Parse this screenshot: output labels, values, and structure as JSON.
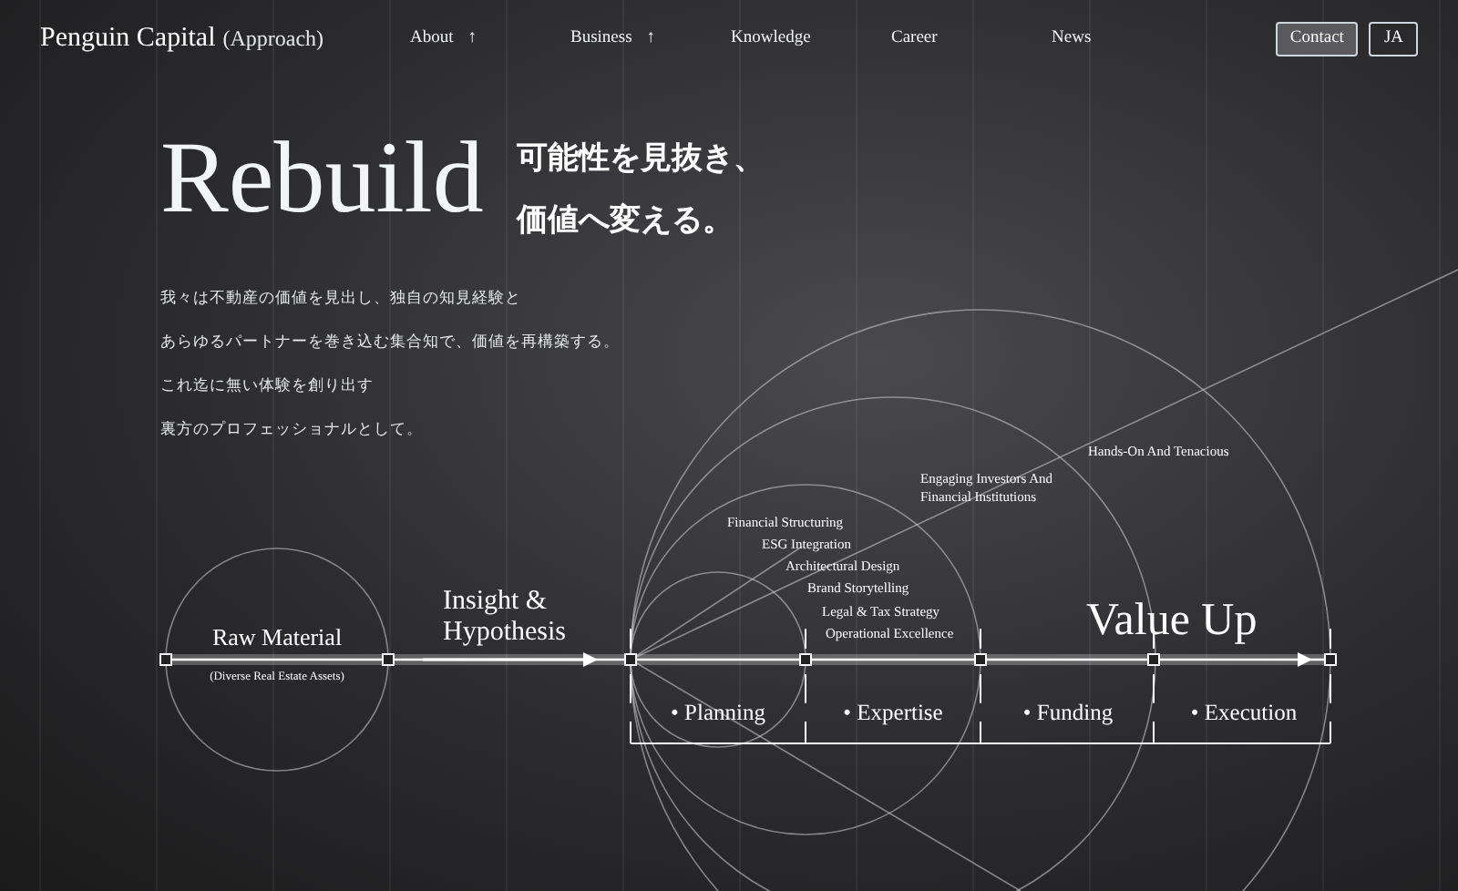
{
  "header": {
    "logo": "Penguin Capital",
    "logo_sub": "(Approach)",
    "nav": [
      {
        "label": "About",
        "arrow": "↑"
      },
      {
        "label": "Business",
        "arrow": "↑"
      },
      {
        "label": "Knowledge"
      },
      {
        "label": "Career"
      },
      {
        "label": "News"
      }
    ],
    "buttons": [
      {
        "label": "Contact",
        "kind": "filled"
      },
      {
        "label": "JA",
        "kind": "outline"
      }
    ]
  },
  "hero": {
    "title": "Rebuild",
    "tagline": [
      "可能性を見抜き、",
      "価値へ変える。"
    ],
    "body": [
      "我々は不動産の価値を見出し、独自の知見経験と",
      "あらゆるパートナーを巻き込む集合知で、価値を再構築する。",
      "これ迄に無い体験を創り出す",
      "裏方のプロフェッショナルとして。"
    ]
  },
  "diagram": {
    "raw_material": "Raw Material",
    "raw_note": "(Diverse Real Estate Assets)",
    "insight": "Insight & Hypothesis",
    "value_up": "Value Up",
    "services": [
      "Financial Structuring",
      "ESG Integration",
      "Architectural Design",
      "Brand Storytelling",
      "Legal & Tax Strategy",
      "Operational Excellence"
    ],
    "investors": "Engaging Investors And Financial Institutions",
    "hands_on": "Hands-On And Tenacious",
    "phases": [
      "• Planning",
      "• Expertise",
      "• Funding",
      "• Execution"
    ]
  }
}
